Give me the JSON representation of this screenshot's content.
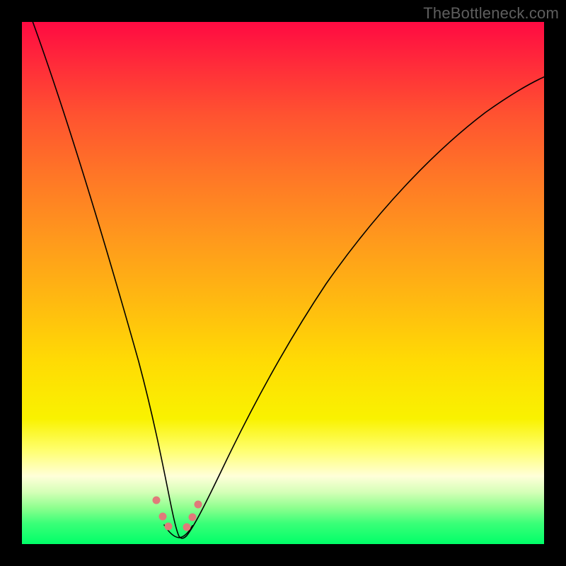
{
  "watermark": "TheBottleneck.com",
  "chart_data": {
    "type": "line",
    "title": "",
    "xlabel": "",
    "ylabel": "",
    "xlim": [
      0,
      100
    ],
    "ylim": [
      0,
      100
    ],
    "grid": false,
    "legend": false,
    "series": [
      {
        "name": "bottleneck-curve",
        "x": [
          0,
          5,
          10,
          15,
          18,
          21,
          24,
          26,
          28,
          29,
          30,
          31,
          33,
          35,
          38,
          42,
          48,
          55,
          63,
          72,
          82,
          92,
          100
        ],
        "y": [
          100,
          84,
          66,
          48,
          37,
          27,
          16,
          9,
          4,
          2,
          1,
          2,
          4,
          8,
          15,
          24,
          36,
          48,
          58,
          67,
          75,
          82,
          87
        ]
      }
    ],
    "highlight_points": {
      "name": "optimal-range-dots",
      "x": [
        25.8,
        27.0,
        28.2,
        31.6,
        32.6,
        33.6
      ],
      "y": [
        8.5,
        5.5,
        3.6,
        3.4,
        5.3,
        7.8
      ]
    },
    "trough_range": {
      "name": "optimal-range-band",
      "x": [
        27.5,
        28.8,
        30.0,
        31.2,
        32.4
      ],
      "y": [
        3.0,
        1.6,
        1.2,
        1.7,
        3.2
      ]
    }
  },
  "colors": {
    "background": "#000000",
    "curve": "#000000",
    "highlight": "#e07a7a",
    "gradient_top": "#ff0a42",
    "gradient_bottom": "#00ff68"
  }
}
